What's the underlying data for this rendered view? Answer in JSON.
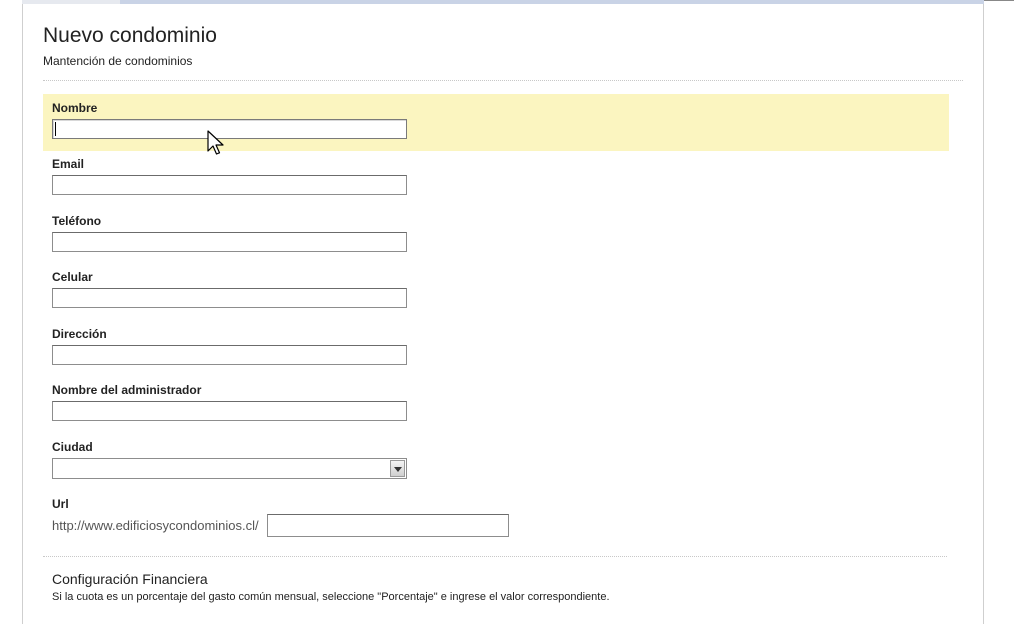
{
  "header": {
    "title": "Nuevo condominio",
    "subtitle": "Mantención de condominios"
  },
  "form": {
    "fields": [
      {
        "label": "Nombre",
        "value": ""
      },
      {
        "label": "Email",
        "value": ""
      },
      {
        "label": "Teléfono",
        "value": ""
      },
      {
        "label": "Celular",
        "value": ""
      },
      {
        "label": "Dirección",
        "value": ""
      },
      {
        "label": "Nombre del administrador",
        "value": ""
      }
    ],
    "city": {
      "label": "Ciudad",
      "selected": ""
    },
    "url": {
      "label": "Url",
      "prefix": "http://www.edificiosycondominios.cl/",
      "value": ""
    }
  },
  "financial": {
    "title": "Configuración Financiera",
    "description": "Si la cuota es un porcentaje del gasto común mensual, seleccione \"Porcentaje\" e ingrese el valor correspondiente."
  },
  "colors": {
    "highlight": "#fbf5c0",
    "topbar": "#c9d3e6"
  },
  "icons": {
    "cursor": "mouse-pointer-icon",
    "dropdown": "chevron-down-icon"
  }
}
